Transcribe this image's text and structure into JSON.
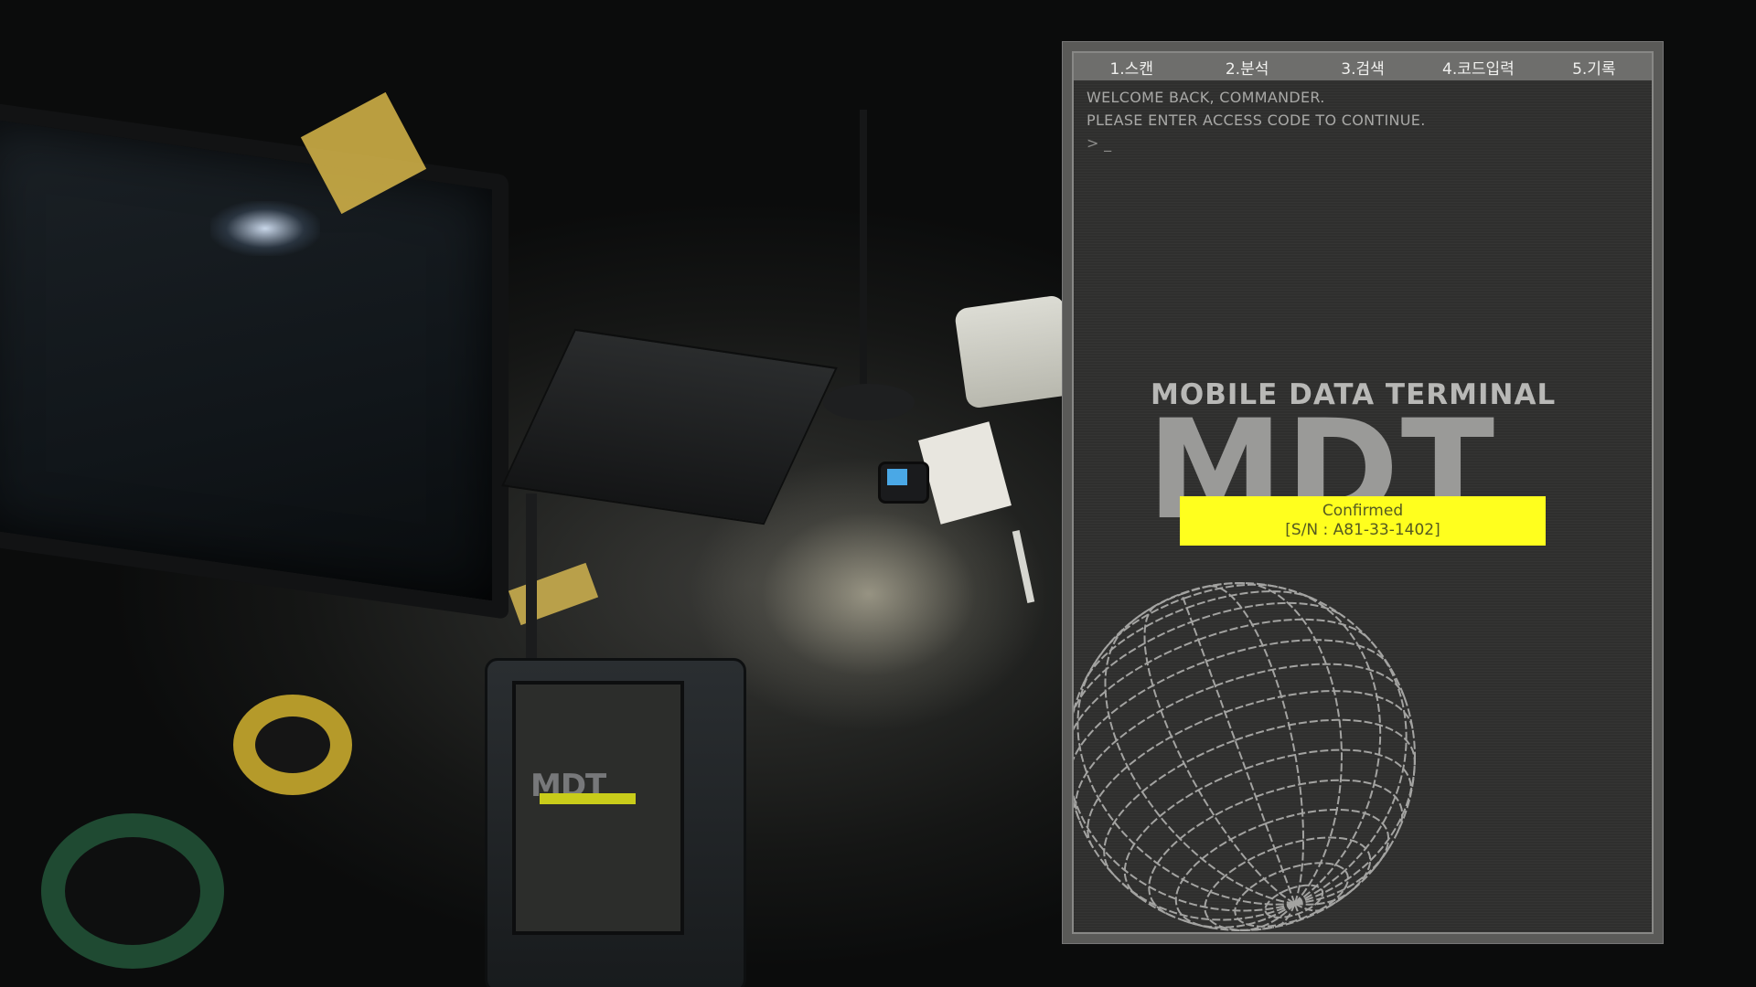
{
  "mdt": {
    "tabs": [
      {
        "label": "1.스캔"
      },
      {
        "label": "2.분석"
      },
      {
        "label": "3.검색"
      },
      {
        "label": "4.코드입력"
      },
      {
        "label": "5.기록"
      }
    ],
    "console": {
      "line1": "WELCOME BACK, COMMANDER.",
      "line2": "PLEASE ENTER ACCESS CODE TO CONTINUE.",
      "prompt": "> _"
    },
    "subtitle": "MOBILE DATA TERMINAL",
    "logo": "MDT",
    "banner": {
      "status": "Confirmed",
      "serial": "[S/N : A81-33-1402]",
      "color": "#ffff1e"
    },
    "colors": {
      "panel": "#2f2f2e",
      "tabbar": "#6e6e6c",
      "globe_lines": "#b8b8b6"
    },
    "icons": [
      "wireframe-globe-icon"
    ]
  }
}
